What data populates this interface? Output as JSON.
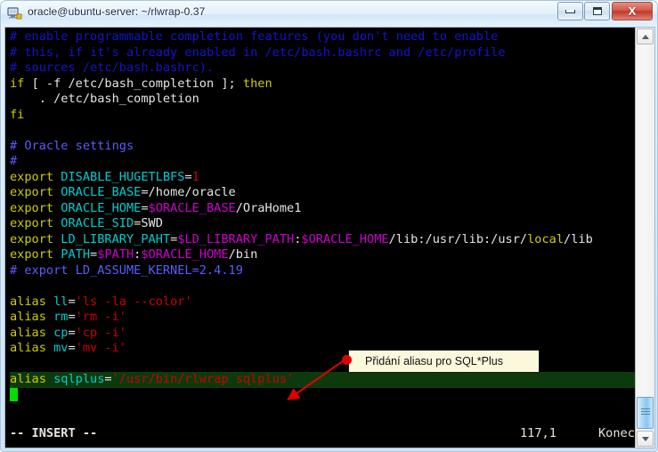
{
  "window": {
    "title": "oracle@ubuntu-server: ~/rlwrap-0.37",
    "icon": "putty-icon",
    "buttons": {
      "minimize": "minimize-button",
      "maximize": "maximize-button",
      "close_label": "X"
    }
  },
  "terminal": {
    "lines": [
      {
        "id": "l1",
        "segments": [
          {
            "t": "# enable programmable completion features (you don't need to enable",
            "c": "c-comment"
          }
        ]
      },
      {
        "id": "l2",
        "segments": [
          {
            "t": "# this, if it's already enabled in /etc/bash.bashrc and /etc/profile",
            "c": "c-comment"
          }
        ]
      },
      {
        "id": "l3",
        "segments": [
          {
            "t": "# sources /etc/bash.bashrc).",
            "c": "c-comment"
          }
        ]
      },
      {
        "id": "l4",
        "segments": [
          {
            "t": "if ",
            "c": "c-key"
          },
          {
            "t": "[ -f /etc/bash_completion ]; ",
            "c": "c-plain"
          },
          {
            "t": "then",
            "c": "c-key"
          }
        ]
      },
      {
        "id": "l5",
        "segments": [
          {
            "t": "    . /etc/bash_completion",
            "c": "c-plain"
          }
        ]
      },
      {
        "id": "l6",
        "segments": [
          {
            "t": "fi",
            "c": "c-key"
          }
        ]
      },
      {
        "id": "l7",
        "segments": [
          {
            "t": "",
            "c": "c-plain"
          }
        ]
      },
      {
        "id": "l8",
        "segments": [
          {
            "t": "# Oracle settings",
            "c": "c-comment-b"
          }
        ]
      },
      {
        "id": "l9",
        "segments": [
          {
            "t": "#",
            "c": "c-comment-b"
          }
        ]
      },
      {
        "id": "l10",
        "segments": [
          {
            "t": "export ",
            "c": "c-key"
          },
          {
            "t": "DISABLE_HUGETLBFS",
            "c": "c-ident"
          },
          {
            "t": "=",
            "c": "c-plain"
          },
          {
            "t": "1",
            "c": "c-num"
          }
        ]
      },
      {
        "id": "l11",
        "segments": [
          {
            "t": "export ",
            "c": "c-key"
          },
          {
            "t": "ORACLE_BASE",
            "c": "c-ident"
          },
          {
            "t": "=/home/oracle",
            "c": "c-plain"
          }
        ]
      },
      {
        "id": "l12",
        "segments": [
          {
            "t": "export ",
            "c": "c-key"
          },
          {
            "t": "ORACLE_HOME",
            "c": "c-ident"
          },
          {
            "t": "=",
            "c": "c-plain"
          },
          {
            "t": "$ORACLE_BASE",
            "c": "c-var"
          },
          {
            "t": "/OraHome1",
            "c": "c-plain"
          }
        ]
      },
      {
        "id": "l13",
        "segments": [
          {
            "t": "export ",
            "c": "c-key"
          },
          {
            "t": "ORACLE_SID",
            "c": "c-ident"
          },
          {
            "t": "=SWD",
            "c": "c-plain"
          }
        ]
      },
      {
        "id": "l14",
        "segments": [
          {
            "t": "export ",
            "c": "c-key"
          },
          {
            "t": "LD_LIBRARY_PAHT",
            "c": "c-ident"
          },
          {
            "t": "=",
            "c": "c-plain"
          },
          {
            "t": "$LD_LIBRARY_PATH",
            "c": "c-var"
          },
          {
            "t": ":",
            "c": "c-plain"
          },
          {
            "t": "$ORACLE_HOME",
            "c": "c-var"
          },
          {
            "t": "/lib:/usr/lib:/usr/",
            "c": "c-plain"
          },
          {
            "t": "local",
            "c": "c-hl"
          },
          {
            "t": "/lib",
            "c": "c-plain"
          }
        ]
      },
      {
        "id": "l15",
        "segments": [
          {
            "t": "export ",
            "c": "c-key"
          },
          {
            "t": "PATH",
            "c": "c-ident"
          },
          {
            "t": "=",
            "c": "c-plain"
          },
          {
            "t": "$PATH",
            "c": "c-var"
          },
          {
            "t": ":",
            "c": "c-plain"
          },
          {
            "t": "$ORACLE_HOME",
            "c": "c-var"
          },
          {
            "t": "/bin",
            "c": "c-plain"
          }
        ]
      },
      {
        "id": "l16",
        "segments": [
          {
            "t": "# export LD_ASSUME_KERNEL=2.4.19",
            "c": "c-comment-b"
          }
        ]
      },
      {
        "id": "l17",
        "segments": [
          {
            "t": "",
            "c": "c-plain"
          }
        ]
      },
      {
        "id": "l18",
        "segments": [
          {
            "t": "alias ",
            "c": "c-key"
          },
          {
            "t": "ll",
            "c": "c-ident"
          },
          {
            "t": "=",
            "c": "c-plain"
          },
          {
            "t": "'ls -la --color'",
            "c": "c-str"
          }
        ]
      },
      {
        "id": "l19",
        "segments": [
          {
            "t": "alias ",
            "c": "c-key"
          },
          {
            "t": "rm",
            "c": "c-ident"
          },
          {
            "t": "=",
            "c": "c-plain"
          },
          {
            "t": "'rm -i'",
            "c": "c-str"
          }
        ]
      },
      {
        "id": "l20",
        "segments": [
          {
            "t": "alias ",
            "c": "c-key"
          },
          {
            "t": "cp",
            "c": "c-ident"
          },
          {
            "t": "=",
            "c": "c-plain"
          },
          {
            "t": "'cp -i'",
            "c": "c-str"
          }
        ]
      },
      {
        "id": "l21",
        "segments": [
          {
            "t": "alias ",
            "c": "c-key"
          },
          {
            "t": "mv",
            "c": "c-ident"
          },
          {
            "t": "=",
            "c": "c-plain"
          },
          {
            "t": "'mv -i'",
            "c": "c-str"
          }
        ]
      },
      {
        "id": "l22",
        "segments": [
          {
            "t": "",
            "c": "c-plain"
          }
        ]
      },
      {
        "id": "l23",
        "highlight": true,
        "segments": [
          {
            "t": "alias ",
            "c": "c-key"
          },
          {
            "t": "sqlplus",
            "c": "c-ident"
          },
          {
            "t": "=",
            "c": "c-plain"
          },
          {
            "t": "'/usr/bin/rlwrap sqlplus'",
            "c": "c-str"
          }
        ]
      },
      {
        "id": "l24",
        "cursor": true,
        "segments": []
      }
    ]
  },
  "statusline": {
    "mode": "-- INSERT --",
    "position": "117,1",
    "end_label": "Konec"
  },
  "scrollbar": {
    "up_icon": "scroll-up-arrow-icon",
    "down_icon": "scroll-down-arrow-icon"
  },
  "annotation": {
    "text": "Přidání aliasu pro SQL*Plus",
    "accent_color": "#e00000",
    "bg_color": "#fcf8dc"
  }
}
